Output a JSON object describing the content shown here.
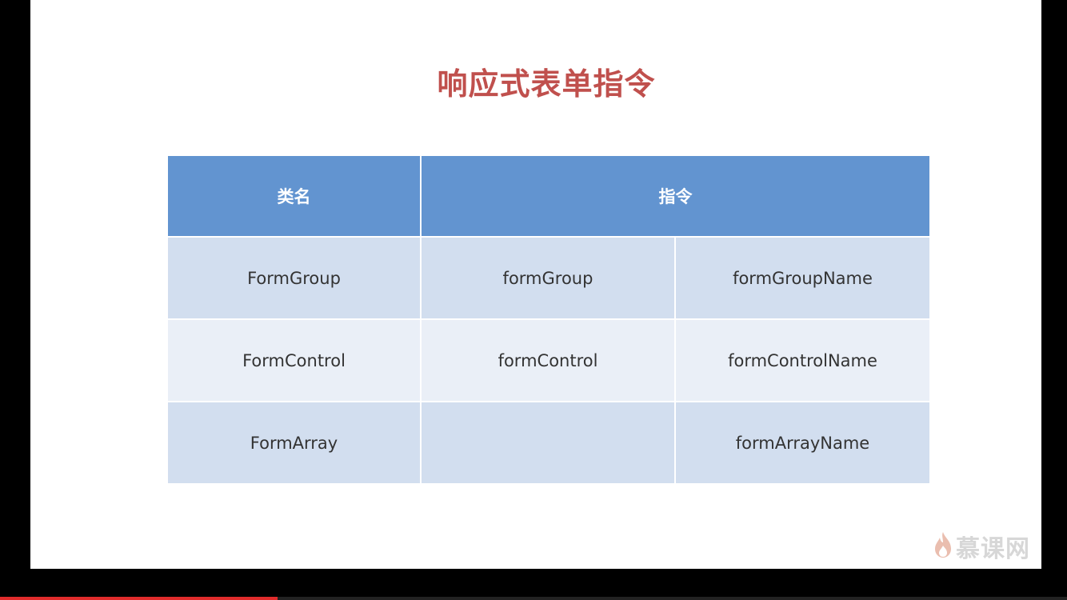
{
  "slide": {
    "title": "响应式表单指令"
  },
  "table": {
    "headers": {
      "class_name": "类名",
      "directive": "指令"
    },
    "rows": [
      {
        "class_name": "FormGroup",
        "directive": "formGroup",
        "name_directive": "formGroupName"
      },
      {
        "class_name": "FormControl",
        "directive": "formControl",
        "name_directive": "formControlName"
      },
      {
        "class_name": "FormArray",
        "directive": "",
        "name_directive": "formArrayName"
      }
    ]
  },
  "watermark": {
    "text": "慕课网",
    "icon": "flame-icon",
    "color": "#b8b8b8"
  },
  "player": {
    "progress_fraction": 0.26,
    "progress_color": "#e02b2b"
  },
  "colors": {
    "title": "#c0504d",
    "header_bg": "#6294d0",
    "row_odd_bg": "#d2deef",
    "row_even_bg": "#eaeff7"
  }
}
